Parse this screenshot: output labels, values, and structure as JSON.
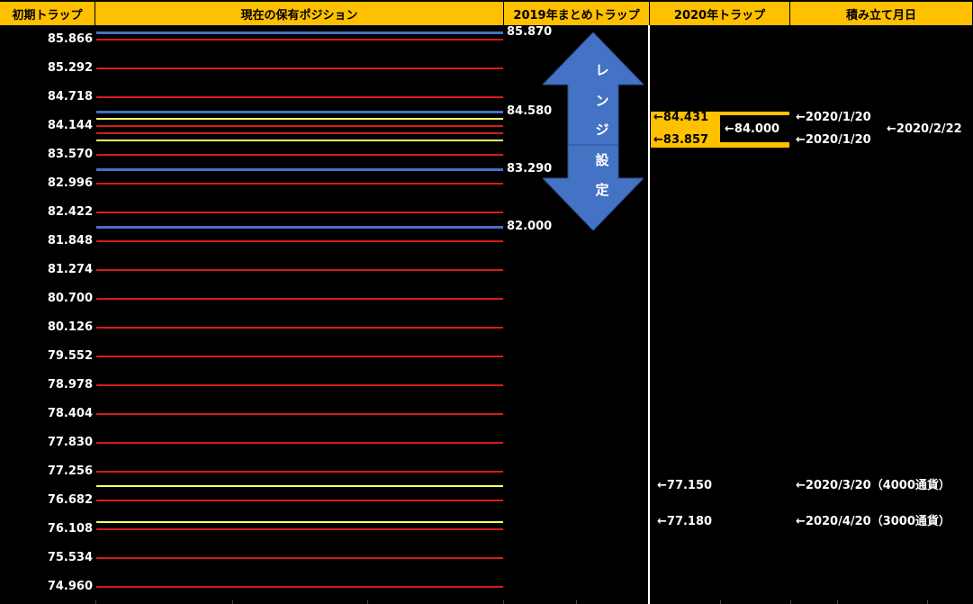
{
  "headers": {
    "initial_trap": "初期トラップ",
    "positions": "現在の保有ポジション",
    "trap_2019": "2019年まとめトラップ",
    "trap_2020": "2020年トラップ",
    "accumulation_date": "積み立て月日"
  },
  "initial_trap_levels": [
    "85.866",
    "85.292",
    "84.718",
    "84.144",
    "83.570",
    "82.996",
    "82.422",
    "81.848",
    "81.274",
    "80.700",
    "80.126",
    "79.552",
    "78.978",
    "78.404",
    "77.830",
    "77.256",
    "76.682",
    "76.108",
    "75.534",
    "74.960"
  ],
  "traps_2019": [
    "85.870",
    "84.580",
    "83.290",
    "82.000"
  ],
  "range_label": [
    "レ",
    "ン",
    "ジ",
    "設",
    "定"
  ],
  "traps_2020": {
    "t1": "←84.431",
    "t2": "←83.857",
    "center": "←84.000",
    "t3": "←77.150",
    "t4": "←77.180"
  },
  "accumulation": {
    "d1": "←2020/1/20",
    "d2": "←2020/1/20",
    "d_range": "←2020/2/22",
    "d3": "←2020/3/20（4000通貨）",
    "d4": "←2020/4/20（3000通貨）"
  },
  "colors": {
    "header": "#FFC000",
    "trap_line": "#d81b1b",
    "position_line": "#ffff66",
    "trap_2019_line": "#4472C4",
    "arrow": "#4472C4"
  }
}
